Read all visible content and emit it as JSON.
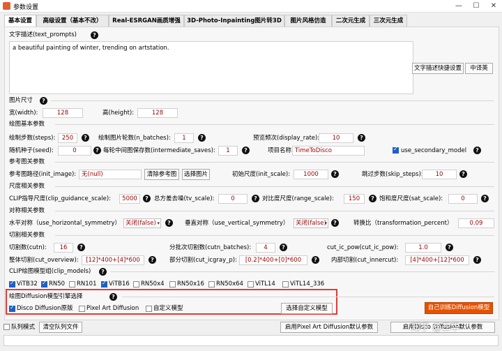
{
  "window": {
    "title": "参数设置",
    "minimize": "—",
    "maximize": "☐",
    "close": "✕"
  },
  "tabs": [
    "基本设置",
    "高级设置（基本不改）",
    "Real-ESRGAN画质增强",
    "3D-Photo-Inpainting图片转3D",
    "图片风格仿造",
    "二次元生成",
    "三次元生成"
  ],
  "text_prompts": {
    "label": "文字描述(text_prompts)",
    "value": "a beautiful painting of winter, trending on artstation.",
    "quick_btn": "文字描述快捷设置",
    "translate_btn": "中译英"
  },
  "image_size": {
    "label": "图片尺寸",
    "width_label": "宽(width):",
    "width": "128",
    "height_label": "高(height):",
    "height": "128"
  },
  "basic": {
    "label": "绘图基本参数",
    "steps_label": "绘制步数(steps):",
    "steps": "250",
    "n_batches_label": "绘制图片轮数(n_batches):",
    "n_batches": "1",
    "display_rate_label": "预览频次(display_rate):",
    "display_rate": "10",
    "seed_label": "随机种子(seed):",
    "seed": "0",
    "intermediate_label": "每轮中间图保存数(intermediate_saves):",
    "intermediate": "1",
    "project_label": "项目名称",
    "project": "TimeToDisco",
    "secondary_label": "use_secondary_model"
  },
  "reference": {
    "label": "参考图关参数",
    "init_image_label": "参考图路径(init_image):",
    "init_image": "无(null)",
    "clear_btn": "清除参考图",
    "choose_btn": "选择图片",
    "init_scale_label": "初始尺度(init_scale):",
    "init_scale": "1000",
    "skip_steps_label": "跳过步数(skip_steps):",
    "skip_steps": "10"
  },
  "scale": {
    "label": "尺度相关参数",
    "clip_guidance_label": "CLIP指导尺度(clip_guidance_scale):",
    "clip_guidance": "5000",
    "tv_label": "总方差去噪(tv_scale):",
    "tv": "0",
    "range_label": "对比度尺度(range_scale):",
    "range": "150",
    "sat_label": "饱和度尺度(sat_scale):",
    "sat": "0"
  },
  "symmetry": {
    "label": "对称相关参数",
    "h_label": "水平对称（use_horizontal_symmetry）",
    "h_value": "关闭(false)",
    "v_label": "垂直对称（use_vertical_symmetry）",
    "v_value": "关闭(false)",
    "t_label": "转换比（transformation_percent）",
    "t_value": "0.09"
  },
  "cut": {
    "label": "切割相关参数",
    "cutn_label": "切割数(cutn):",
    "cutn": "16",
    "cutn_batches_label": "分批次切割数(cutn_batches):",
    "cutn_batches": "4",
    "cut_ic_pow_label": "cut_ic_pow(cut_ic_pow):",
    "cut_ic_pow": "1.0",
    "overview_label": "整体切割(cut_overview):",
    "overview": "[12]*400+[4]*600",
    "icgray_label": "部分切割(cut_icgray_p):",
    "icgray": "[0.2]*400+[0]*600",
    "innercut_label": "内部切割(cut_innercut):",
    "innercut": "[4]*400+[12]*600"
  },
  "clip_models": {
    "label": "CLIP绘图模型组(clip_models)",
    "items": [
      {
        "name": "ViTB32",
        "on": true
      },
      {
        "name": "RN50",
        "on": true
      },
      {
        "name": "RN101",
        "on": false
      },
      {
        "name": "ViTB16",
        "on": true
      },
      {
        "name": "RN50x4",
        "on": false
      },
      {
        "name": "RN50x16",
        "on": false
      },
      {
        "name": "RN50x64",
        "on": false
      },
      {
        "name": "ViTL14",
        "on": false
      },
      {
        "name": "ViTL14_336",
        "on": false
      }
    ]
  },
  "engine": {
    "label": "绘图Diffusion模型引擎选择",
    "items": [
      {
        "name": "Disco Diffusion原版",
        "on": true
      },
      {
        "name": "Pixel Art Diffusion",
        "on": false
      },
      {
        "name": "自定义模型",
        "on": false
      }
    ],
    "choose_btn": "选择自定义模型",
    "train_btn": "自己训练Diffusion模型"
  },
  "bottom": {
    "queue_label": "队列模式",
    "clear_queue_btn": "清空队列文件",
    "pixel_default_btn": "启用Pixel Art Diffusion默认参数",
    "disco_default_btn": "启用Disco Diffusion默认参数"
  },
  "watermark": "知乎 @三华",
  "help_glyph": "?"
}
